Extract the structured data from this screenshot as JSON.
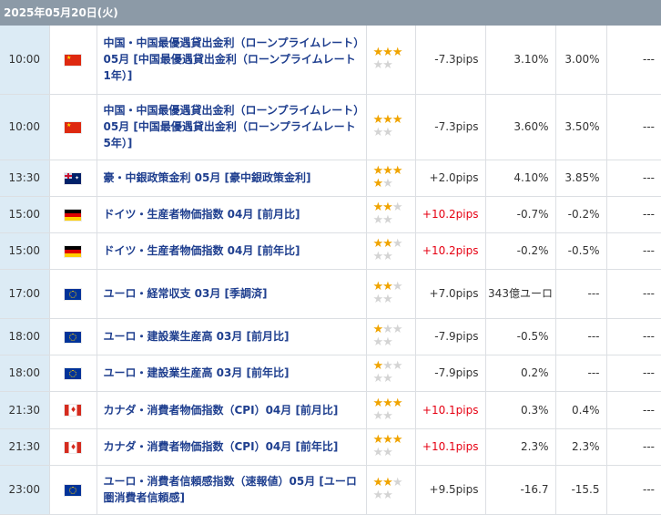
{
  "header": {
    "date": "2025年05月20日(火)"
  },
  "stars_full": "★",
  "stars_empty": "★",
  "rows": [
    {
      "time": "10:00",
      "flag": "cn-flag",
      "name": "中国・中国最優遇貸出金利（ローンプライムレート）05月 [中国最優遇貸出金利（ローンプライムレート　1年）]",
      "pips": "-7.3pips",
      "c1": "3.10%",
      "c2": "3.00%",
      "c3": "---",
      "importance": 3
    },
    {
      "time": "10:00",
      "flag": "cn-flag",
      "name": "中国・中国最優遇貸出金利（ローンプライムレート）05月 [中国最優遇貸出金利（ローンプライムレート　5年）]",
      "pips": "-7.3pips",
      "c1": "3.60%",
      "c2": "3.50%",
      "c3": "---",
      "importance": 3
    },
    {
      "time": "13:30",
      "flag": "au-flag",
      "name": "豪・中銀政策金利 05月 [豪中銀政策金利]",
      "pips": "+2.0pips",
      "c1": "4.10%",
      "c2": "3.85%",
      "c3": "---",
      "importance": 4
    },
    {
      "time": "15:00",
      "flag": "de-flag",
      "name": "ドイツ・生産者物価指数 04月 [前月比]",
      "pips": "+10.2pips",
      "c1": "-0.7%",
      "c2": "-0.2%",
      "c3": "---",
      "importance": 2
    },
    {
      "time": "15:00",
      "flag": "de-flag",
      "name": "ドイツ・生産者物価指数 04月 [前年比]",
      "pips": "+10.2pips",
      "c1": "-0.2%",
      "c2": "-0.5%",
      "c3": "---",
      "importance": 2
    },
    {
      "time": "17:00",
      "flag": "eu-flag",
      "name": "ユーロ・経常収支 03月 [季調済]",
      "pips": "+7.0pips",
      "c1": "343億ユーロ",
      "c2": "---",
      "c3": "---",
      "importance": 2
    },
    {
      "time": "18:00",
      "flag": "eu-flag",
      "name": "ユーロ・建設業生産高 03月 [前月比]",
      "pips": "-7.9pips",
      "c1": "-0.5%",
      "c2": "---",
      "c3": "---",
      "importance": 1
    },
    {
      "time": "18:00",
      "flag": "eu-flag",
      "name": "ユーロ・建設業生産高 03月 [前年比]",
      "pips": "-7.9pips",
      "c1": "0.2%",
      "c2": "---",
      "c3": "---",
      "importance": 1
    },
    {
      "time": "21:30",
      "flag": "ca-flag",
      "name": "カナダ・消費者物価指数（CPI）04月 [前月比]",
      "pips": "+10.1pips",
      "c1": "0.3%",
      "c2": "0.4%",
      "c3": "---",
      "importance": 3
    },
    {
      "time": "21:30",
      "flag": "ca-flag",
      "name": "カナダ・消費者物価指数（CPI）04月 [前年比]",
      "pips": "+10.1pips",
      "c1": "2.3%",
      "c2": "2.3%",
      "c3": "---",
      "importance": 3
    },
    {
      "time": "23:00",
      "flag": "eu-flag",
      "name": "ユーロ・消費者信頼感指数（速報値）05月 [ユーロ圏消費者信頼感]",
      "pips": "+9.5pips",
      "c1": "-16.7",
      "c2": "-15.5",
      "c3": "---",
      "importance": 2
    }
  ],
  "colors": {
    "header_bg": "#8c9aa7",
    "time_bg": "#dcebf5",
    "link": "#1f3f8f",
    "star": "#f0a400",
    "positive_pips": "#e60012"
  }
}
